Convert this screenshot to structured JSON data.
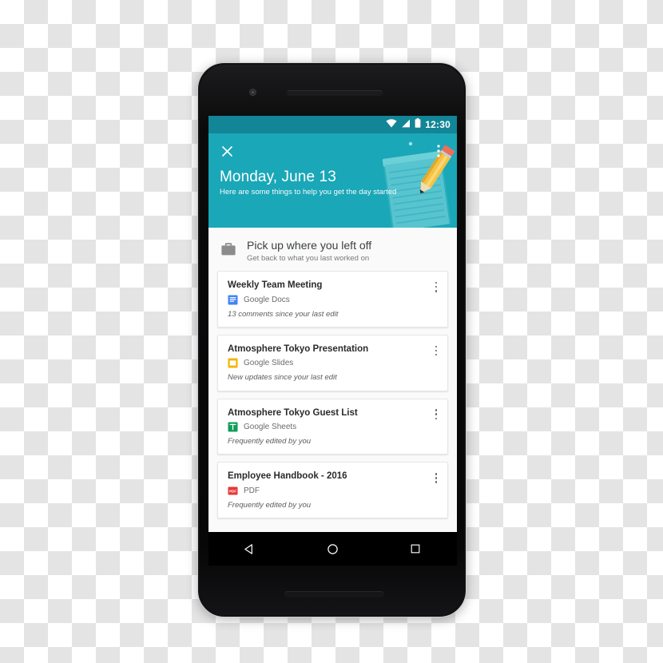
{
  "scene": {
    "backdrop": "transparency-checkerboard",
    "device": "android-smartphone-mockup"
  },
  "statusbar": {
    "time": "12:30",
    "icons": [
      "wifi-icon",
      "cellular-signal-icon",
      "battery-icon"
    ]
  },
  "hero": {
    "close_label": "×",
    "overflow_label": "more-options",
    "title": "Monday, June 13",
    "subtitle": "Here are some things to help you get the day started",
    "illustration": "notepad-and-pencil-illustration",
    "bg_color": "#1aa7b8",
    "statusbar_color": "#128596"
  },
  "section": {
    "icon": "briefcase-icon",
    "title": "Pick up where you left off",
    "subtitle": "Get back to what you last worked on"
  },
  "cards": [
    {
      "title": "Weekly Team Meeting",
      "app": "Google Docs",
      "app_icon": "google-docs-icon",
      "app_color": "#4285f4",
      "note": "13 comments since your last edit"
    },
    {
      "title": "Atmosphere Tokyo Presentation",
      "app": "Google Slides",
      "app_icon": "google-slides-icon",
      "app_color": "#f4b400",
      "note": "New updates since your last edit"
    },
    {
      "title": "Atmosphere Tokyo Guest List",
      "app": "Google Sheets",
      "app_icon": "google-sheets-icon",
      "app_color": "#0f9d58",
      "note": "Frequently edited by you"
    },
    {
      "title": "Employee Handbook - 2016",
      "app": "PDF",
      "app_icon": "pdf-icon",
      "app_color": "#e53935",
      "note": "Frequently edited by you"
    }
  ],
  "navbar": {
    "back_label": "back",
    "home_label": "home",
    "recents_label": "recent-apps"
  }
}
